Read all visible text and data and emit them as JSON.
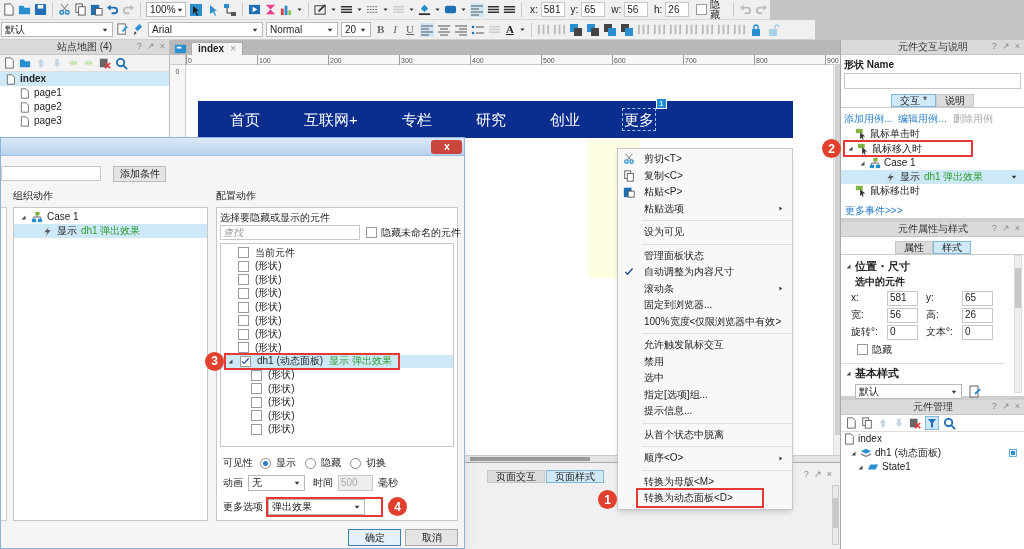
{
  "toolbar": {
    "zoom": "100%",
    "style": "默认",
    "font": "Arial",
    "font_style": "Normal",
    "font_size": "20",
    "bold": "B",
    "italic": "I",
    "underline": "U",
    "text_color": "A",
    "geometry": [
      {
        "label": "x:",
        "value": "581"
      },
      {
        "label": "y:",
        "value": "65"
      },
      {
        "label": "w:",
        "value": "56"
      },
      {
        "label": "h:",
        "value": "26"
      }
    ],
    "hidden": {
      "label": "隐藏",
      "checked": false
    }
  },
  "sitemap": {
    "title": "站点地图 (4)",
    "controls": [
      "?",
      "↗",
      "×"
    ],
    "pages": [
      {
        "label": "index",
        "selected": true,
        "children": [
          {
            "label": "page1",
            "selected": false
          },
          {
            "label": "page2",
            "selected": false
          },
          {
            "label": "page3",
            "selected": false
          }
        ]
      }
    ]
  },
  "canvas": {
    "tab": {
      "label": "index",
      "close": "×"
    },
    "ruler_marks": [
      "0",
      "100",
      "200",
      "300",
      "400",
      "500",
      "600",
      "700",
      "800",
      "900"
    ],
    "vertical_ruler_marks": [
      "0"
    ],
    "nav": [
      {
        "label": "首页",
        "selected": false
      },
      {
        "label": "互联网+",
        "selected": false
      },
      {
        "label": "专栏",
        "selected": false
      },
      {
        "label": "研究",
        "selected": false
      },
      {
        "label": "创业",
        "selected": false
      },
      {
        "label": "更多",
        "selected": true,
        "note": "1"
      }
    ]
  },
  "bottom_panel": {
    "tabs": [
      {
        "label": "页面交互",
        "selected": false
      },
      {
        "label": "页面样式",
        "selected": true
      }
    ],
    "controls": [
      "?",
      "↗",
      "×"
    ]
  },
  "dialog": {
    "add_condition": "添加条件",
    "organize_title": "组织动作",
    "cases": [
      {
        "label": "Case 1",
        "actions": [
          {
            "verb": "显示",
            "target": "dh1 弹出效果",
            "selected": true
          }
        ]
      }
    ],
    "configure_title": "配置动作",
    "picker_label": "选择要隐藏或显示的元件",
    "search_placeholder": "查找",
    "hide_unnamed": {
      "label": "隐藏未命名的元件",
      "checked": false
    },
    "widgets": [
      {
        "label": "当前元件",
        "checked": false,
        "selected": false
      },
      {
        "label": "(形状)",
        "checked": false,
        "selected": false
      },
      {
        "label": "(形状)",
        "checked": false,
        "selected": false
      },
      {
        "label": "(形状)",
        "checked": false,
        "selected": false
      },
      {
        "label": "(形状)",
        "checked": false,
        "selected": false
      },
      {
        "label": "(形状)",
        "checked": false,
        "selected": false
      },
      {
        "label": "(形状)",
        "checked": false,
        "selected": false
      },
      {
        "label": "(形状)",
        "checked": false,
        "selected": false
      },
      {
        "label": "dh1 (动态面板)",
        "note": "显示 弹出效果",
        "checked": true,
        "selected": true,
        "annotation": "3",
        "children": [
          {
            "label": "(形状)",
            "checked": false,
            "selected": false
          },
          {
            "label": "(形状)",
            "checked": false,
            "selected": false
          },
          {
            "label": "(形状)",
            "checked": false,
            "selected": false
          },
          {
            "label": "(形状)",
            "checked": false,
            "selected": false
          },
          {
            "label": "(形状)",
            "checked": false,
            "selected": false
          }
        ]
      }
    ],
    "visibility": {
      "label": "可见性",
      "options": [
        {
          "label": "显示",
          "selected": true
        },
        {
          "label": "隐藏",
          "selected": false
        },
        {
          "label": "切换",
          "selected": false
        }
      ]
    },
    "animation": {
      "label": "动画",
      "value": "无"
    },
    "duration": {
      "label": "时间",
      "value": "500",
      "unit": "毫秒",
      "disabled": true
    },
    "more_options": {
      "label": "更多选项",
      "value": "弹出效果",
      "annotation": "4"
    },
    "buttons": [
      {
        "label": "确定",
        "default": true
      },
      {
        "label": "取消",
        "default": false
      }
    ]
  },
  "context_menu": {
    "items": [
      {
        "kind": "item",
        "label": "剪切<T>",
        "checked": false,
        "submenu": false
      },
      {
        "kind": "item",
        "label": "复制<C>",
        "checked": false,
        "submenu": false
      },
      {
        "kind": "item",
        "label": "粘贴<P>",
        "checked": false,
        "submenu": false
      },
      {
        "kind": "item",
        "label": "粘贴选项",
        "checked": false,
        "submenu": true
      },
      {
        "kind": "separator"
      },
      {
        "kind": "item",
        "label": "设为可见",
        "checked": false,
        "submenu": false
      },
      {
        "kind": "separator"
      },
      {
        "kind": "item",
        "label": "管理面板状态",
        "checked": false,
        "submenu": false
      },
      {
        "kind": "item",
        "label": "自动调整为内容尺寸",
        "checked": true,
        "submenu": false
      },
      {
        "kind": "item",
        "label": "滚动条",
        "checked": false,
        "submenu": true
      },
      {
        "kind": "item",
        "label": "固定到浏览器...",
        "checked": false,
        "submenu": false
      },
      {
        "kind": "item",
        "label": "100%宽度<仅限浏览器中有效>",
        "checked": false,
        "submenu": false
      },
      {
        "kind": "separator"
      },
      {
        "kind": "item",
        "label": "允许触发鼠标交互",
        "checked": false,
        "submenu": false
      },
      {
        "kind": "item",
        "label": "禁用",
        "checked": false,
        "submenu": false
      },
      {
        "kind": "item",
        "label": "选中",
        "checked": false,
        "submenu": false
      },
      {
        "kind": "item",
        "label": "指定[选项]组...",
        "checked": false,
        "submenu": false
      },
      {
        "kind": "item",
        "label": "提示信息...",
        "checked": false,
        "submenu": false
      },
      {
        "kind": "separator"
      },
      {
        "kind": "item",
        "label": "从首个状态中脱离",
        "checked": false,
        "submenu": false
      },
      {
        "kind": "separator"
      },
      {
        "kind": "item",
        "label": "顺序<O>",
        "checked": false,
        "submenu": true
      },
      {
        "kind": "separator"
      },
      {
        "kind": "item",
        "label": "转换为母版<M>",
        "checked": false,
        "submenu": false
      },
      {
        "kind": "item",
        "label": "转换为动态面板<D>",
        "checked": false,
        "submenu": false,
        "annotation": "1"
      }
    ]
  },
  "interaction_panel": {
    "title": "元件交互与说明",
    "controls": [
      "?",
      "↗",
      "×"
    ],
    "name_label": "形状 Name",
    "tabs": [
      {
        "label": "交互 *",
        "selected": true
      },
      {
        "label": "说明",
        "selected": false
      }
    ],
    "links": [
      {
        "label": "添加用例...",
        "disabled": false
      },
      {
        "label": "编辑用例...",
        "disabled": false
      },
      {
        "label": "删除用例",
        "disabled": true
      }
    ],
    "events": [
      {
        "label": "鼠标单击时",
        "expanded": false
      },
      {
        "label": "鼠标移入时",
        "expanded": true,
        "annotation": "2",
        "cases": [
          {
            "label": "Case 1",
            "actions": [
              {
                "verb": "显示",
                "target": "dh1 弹出效果",
                "selected": true
              }
            ]
          }
        ]
      },
      {
        "label": "鼠标移出时",
        "expanded": false
      }
    ],
    "more_events": "更多事件>>>"
  },
  "style_panel": {
    "title": "元件属性与样式",
    "controls": [
      "?",
      "↗",
      "×"
    ],
    "tabs": [
      {
        "label": "属性",
        "selected": false
      },
      {
        "label": "样式",
        "selected": true
      }
    ],
    "position_title": "位置・尺寸",
    "selected_label": "选中的元件",
    "fields": [
      {
        "label": "x:",
        "value": "581"
      },
      {
        "label": "y:",
        "value": "65"
      },
      {
        "label": "宽:",
        "value": "56"
      },
      {
        "label": "高:",
        "value": "26"
      },
      {
        "label": "旋转°:",
        "value": "0"
      },
      {
        "label": "文本°:",
        "value": "0"
      }
    ],
    "hidden": {
      "label": "隐藏",
      "checked": false
    },
    "style_title": "基本样式",
    "style_value": "默认"
  },
  "outline_panel": {
    "title": "元件管理",
    "controls": [
      "?",
      "↗",
      "×"
    ],
    "tree": [
      {
        "kind": "page",
        "label": "index",
        "children": [
          {
            "kind": "panel",
            "label": "dh1 (动态面板)",
            "children": [
              {
                "kind": "state",
                "label": "State1"
              }
            ]
          }
        ]
      }
    ]
  }
}
